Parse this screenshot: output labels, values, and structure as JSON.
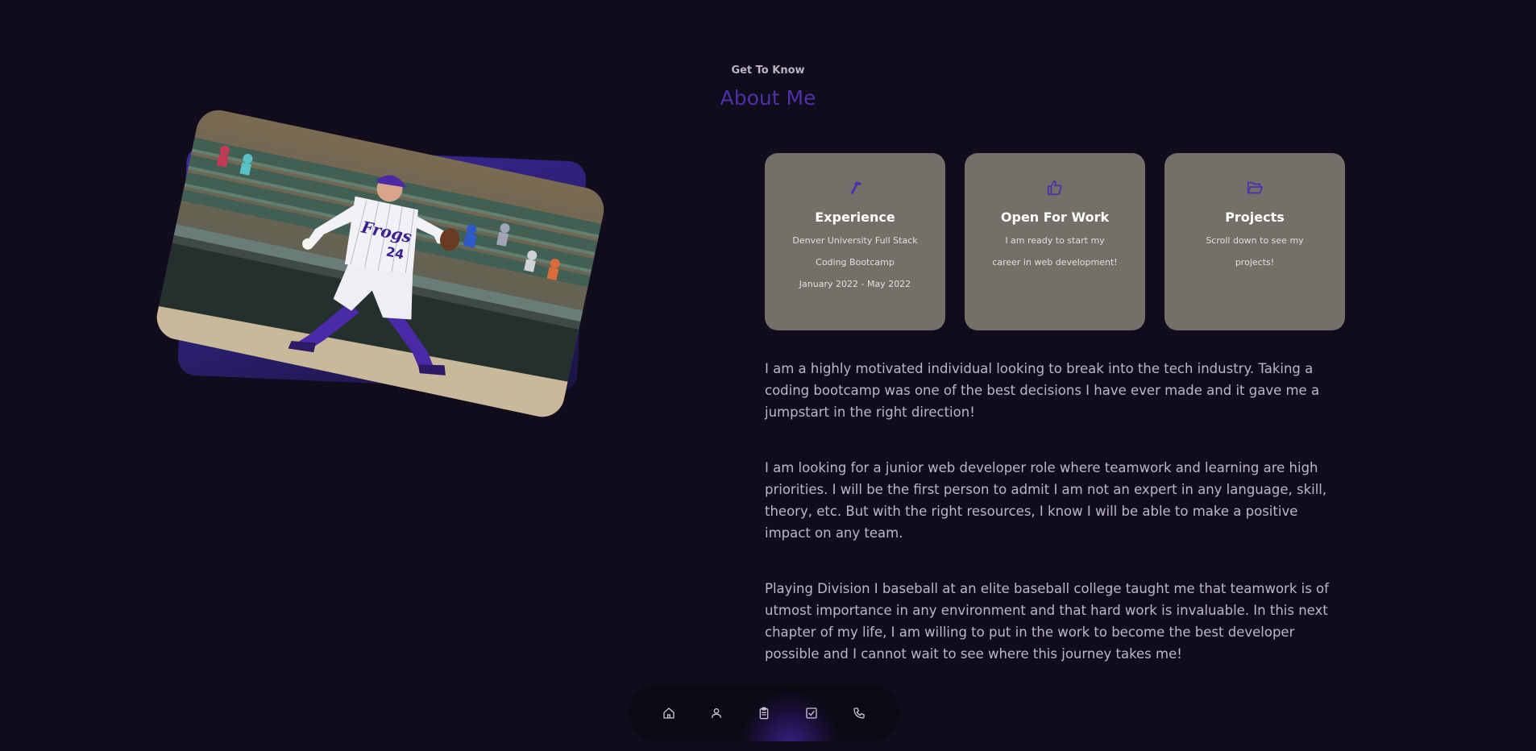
{
  "header": {
    "eyebrow": "Get To Know",
    "title": "About Me"
  },
  "photo": {
    "alt": "Baseball pitcher in TCU Frogs uniform number 24 mid-throw"
  },
  "cards": [
    {
      "icon": "hammer-icon",
      "title": "Experience",
      "lines": [
        "Denver University Full Stack",
        "Coding Bootcamp",
        "January 2022 - May 2022"
      ]
    },
    {
      "icon": "thumbs-up-icon",
      "title": "Open For Work",
      "lines": [
        "I am ready to start my",
        "career in web development!"
      ]
    },
    {
      "icon": "folder-open-icon",
      "title": "Projects",
      "lines": [
        "Scroll down to see my",
        "projects!"
      ]
    }
  ],
  "paragraphs": [
    "I am a highly motivated individual looking to break into the tech industry. Taking a coding bootcamp was one of the best decisions I have ever made and it gave me a jumpstart in the right direction!",
    "I am looking for a junior web developer role where teamwork and learning are high priorities. I will be the first person to admit I am not an expert in any language, skill, theory, etc. But with the right resources, I know I will be able to make a positive impact on any team.",
    "Playing Division I baseball at an elite baseball college taught me that teamwork is of utmost importance in any environment and that hard work is invaluable. In this next chapter of my life, I am willing to put in the work to become the best developer possible and I cannot wait to see where this journey takes me!"
  ],
  "nav": {
    "items": [
      "home-icon",
      "user-icon",
      "clipboard-icon",
      "checklist-icon",
      "phone-icon"
    ],
    "active_index": 2
  },
  "colors": {
    "accent": "#4a32a8",
    "card_bg": "#747069",
    "page_bg": "#110c1c"
  }
}
